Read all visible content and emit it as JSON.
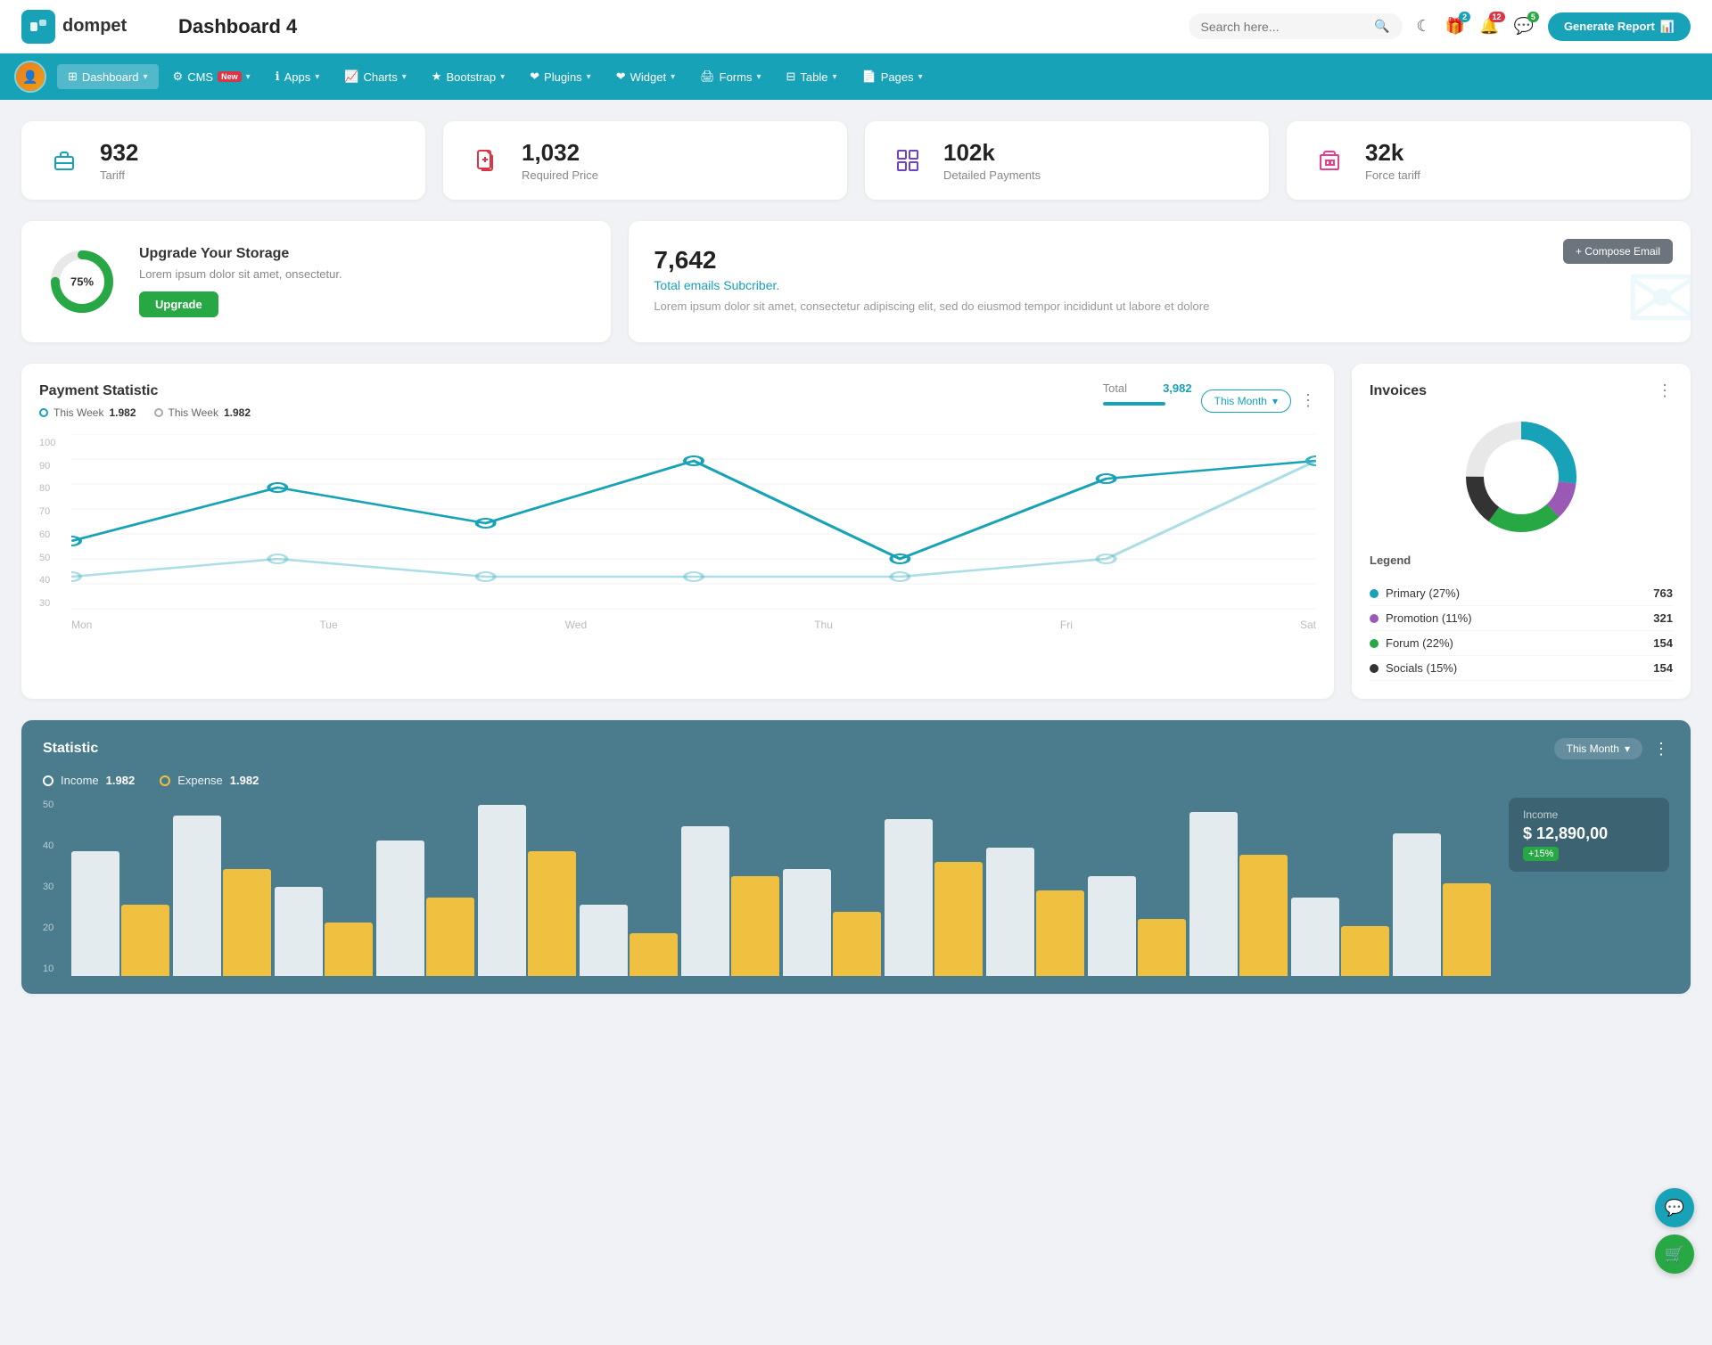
{
  "header": {
    "logo_text": "dompet",
    "page_title": "Dashboard 4",
    "search_placeholder": "Search here...",
    "generate_btn": "Generate Report",
    "icons": {
      "gift_badge": "2",
      "bell_badge": "12",
      "chat_badge": "5"
    }
  },
  "nav": {
    "items": [
      {
        "label": "Dashboard",
        "active": true,
        "has_arrow": true
      },
      {
        "label": "CMS",
        "active": false,
        "badge": "New",
        "has_arrow": true
      },
      {
        "label": "Apps",
        "active": false,
        "has_arrow": true
      },
      {
        "label": "Charts",
        "active": false,
        "has_arrow": true
      },
      {
        "label": "Bootstrap",
        "active": false,
        "has_arrow": true
      },
      {
        "label": "Plugins",
        "active": false,
        "has_arrow": true
      },
      {
        "label": "Widget",
        "active": false,
        "has_arrow": true
      },
      {
        "label": "Forms",
        "active": false,
        "has_arrow": true
      },
      {
        "label": "Table",
        "active": false,
        "has_arrow": true
      },
      {
        "label": "Pages",
        "active": false,
        "has_arrow": true
      }
    ]
  },
  "stats": [
    {
      "number": "932",
      "label": "Tariff",
      "icon": "briefcase",
      "color": "teal"
    },
    {
      "number": "1,032",
      "label": "Required Price",
      "icon": "file-plus",
      "color": "red"
    },
    {
      "number": "102k",
      "label": "Detailed Payments",
      "icon": "grid",
      "color": "purple"
    },
    {
      "number": "32k",
      "label": "Force tariff",
      "icon": "building",
      "color": "pink"
    }
  ],
  "storage": {
    "percent": "75%",
    "title": "Upgrade Your Storage",
    "desc": "Lorem ipsum dolor sit amet, onsectetur.",
    "btn": "Upgrade"
  },
  "email": {
    "count": "7,642",
    "subtitle": "Total emails Subcriber.",
    "desc": "Lorem ipsum dolor sit amet, consectetur adipiscing elit, sed do eiusmod tempor incididunt ut labore et dolore",
    "compose_btn": "+ Compose Email"
  },
  "payment_statistic": {
    "title": "Payment Statistic",
    "legend1_label": "This Week",
    "legend1_val": "1.982",
    "legend2_label": "This Week",
    "legend2_val": "1.982",
    "filter": "This Month",
    "total_label": "Total",
    "total_val": "3,982",
    "x_labels": [
      "Mon",
      "Tue",
      "Wed",
      "Thu",
      "Fri",
      "Sat"
    ],
    "y_labels": [
      "100",
      "90",
      "80",
      "70",
      "60",
      "50",
      "40",
      "30"
    ],
    "line1_points": "60,40 120,70 180,50 240,80 310,40 370,65 440,65 500,90 570,65 640,90",
    "line2_points": "60,80 120,70 180,80 240,80 310,80 370,65 440,65 500,80 570,80 640,80"
  },
  "invoices": {
    "title": "Invoices",
    "legend": [
      {
        "label": "Primary (27%)",
        "color": "#17a2b8",
        "value": "763"
      },
      {
        "label": "Promotion (11%)",
        "color": "#9b59b6",
        "value": "321"
      },
      {
        "label": "Forum (22%)",
        "color": "#28a745",
        "value": "154"
      },
      {
        "label": "Socials (15%)",
        "color": "#333",
        "value": "154"
      }
    ]
  },
  "statistic": {
    "title": "Statistic",
    "filter": "This Month",
    "income_label": "Income",
    "income_val": "1.982",
    "expense_label": "Expense",
    "expense_val": "1.982",
    "income_box_title": "Income",
    "income_box_val": "$ 12,890,00",
    "income_badge": "+15%",
    "y_labels": [
      "50",
      "40",
      "30",
      "20",
      "10"
    ],
    "bars": [
      {
        "white": 35,
        "yellow": 20
      },
      {
        "white": 45,
        "yellow": 30
      },
      {
        "white": 25,
        "yellow": 15
      },
      {
        "white": 38,
        "yellow": 22
      },
      {
        "white": 48,
        "yellow": 35
      },
      {
        "white": 20,
        "yellow": 12
      },
      {
        "white": 42,
        "yellow": 28
      },
      {
        "white": 30,
        "yellow": 18
      },
      {
        "white": 44,
        "yellow": 32
      },
      {
        "white": 36,
        "yellow": 24
      },
      {
        "white": 28,
        "yellow": 16
      },
      {
        "white": 46,
        "yellow": 34
      },
      {
        "white": 22,
        "yellow": 14
      },
      {
        "white": 40,
        "yellow": 26
      }
    ]
  }
}
